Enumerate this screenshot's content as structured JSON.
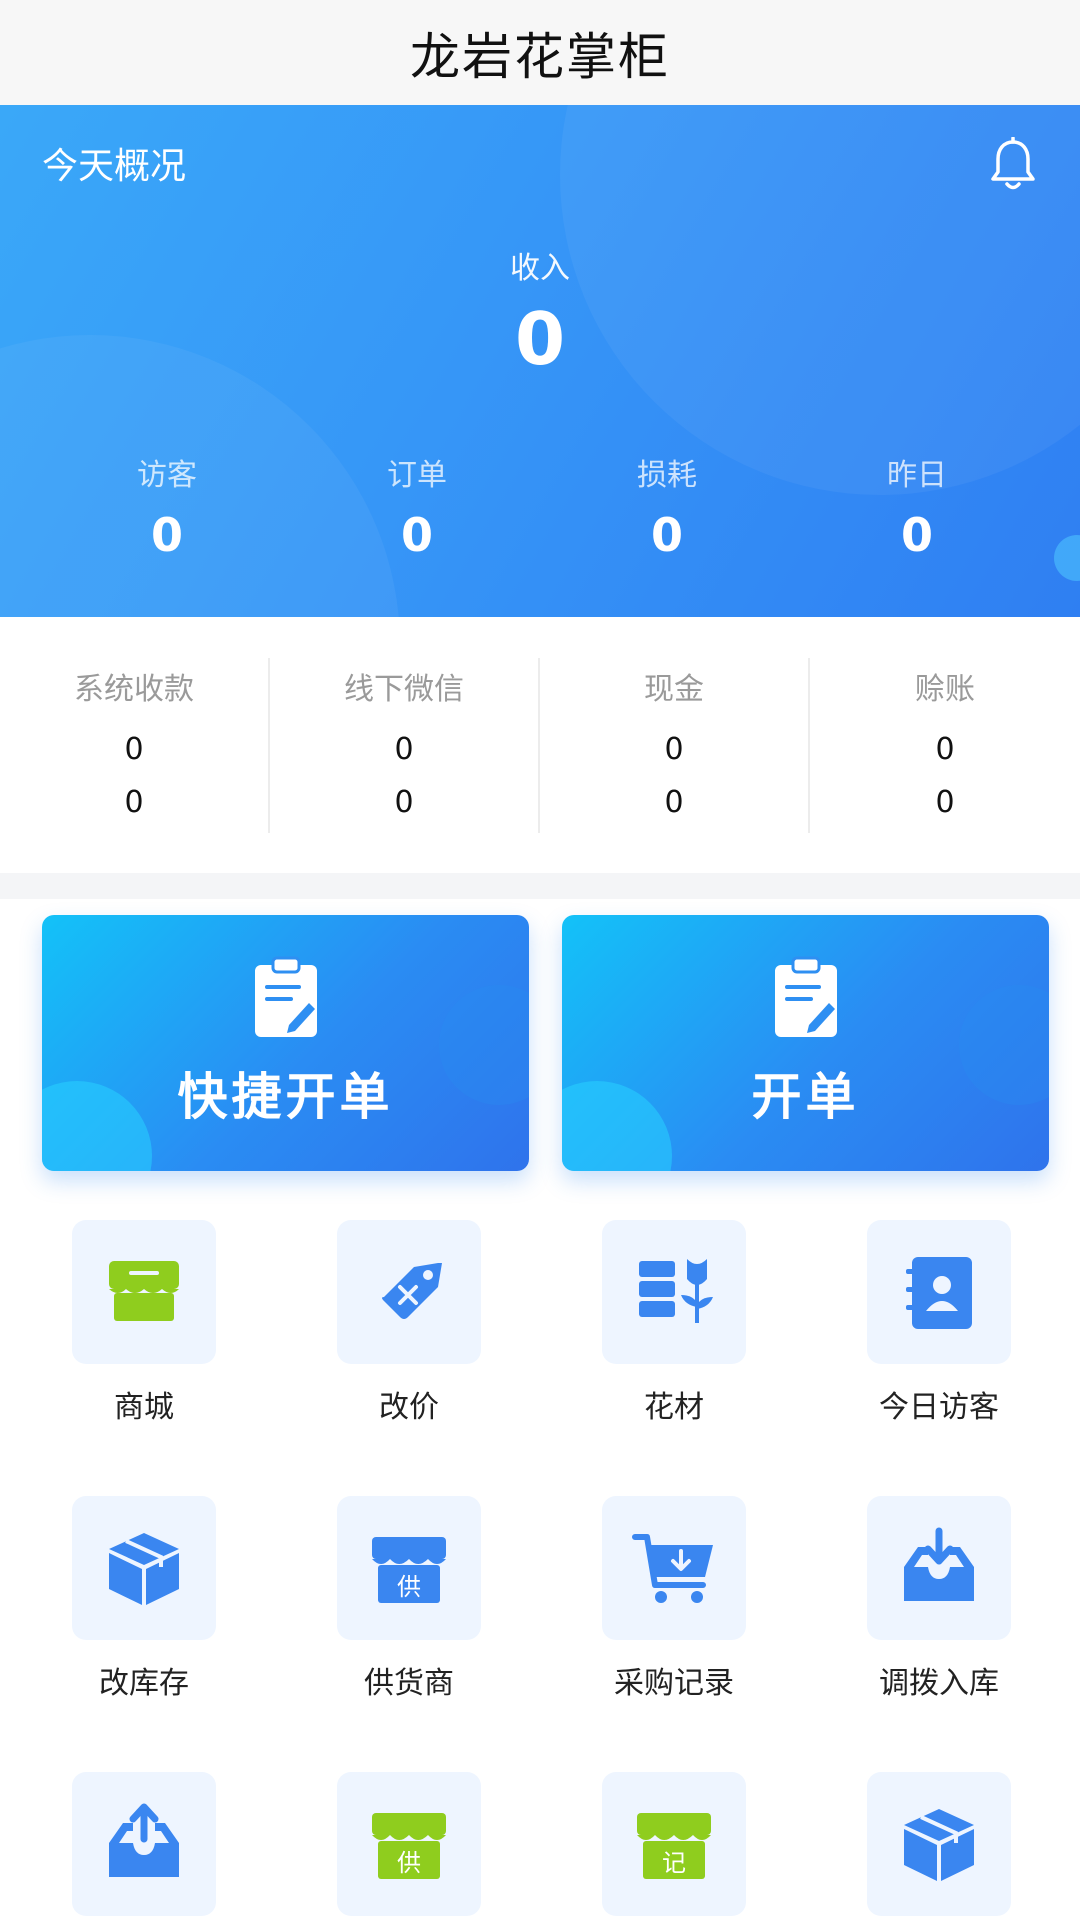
{
  "app": {
    "title": "龙岩花掌柜"
  },
  "overview": {
    "title": "今天概况",
    "income_label": "收入",
    "income_value": "0",
    "stats": [
      {
        "label": "访客",
        "value": "0"
      },
      {
        "label": "订单",
        "value": "0"
      },
      {
        "label": "损耗",
        "value": "0"
      },
      {
        "label": "昨日",
        "value": "0"
      }
    ]
  },
  "payments": [
    {
      "label": "系统收款",
      "value1": "0",
      "value2": "0"
    },
    {
      "label": "线下微信",
      "value1": "0",
      "value2": "0"
    },
    {
      "label": "现金",
      "value1": "0",
      "value2": "0"
    },
    {
      "label": "赊账",
      "value1": "0",
      "value2": "0"
    }
  ],
  "actions": {
    "quick_order": "快捷开单",
    "open_order": "开单"
  },
  "grid": [
    {
      "label": "商城",
      "icon": "store-icon"
    },
    {
      "label": "改价",
      "icon": "price-tag-icon"
    },
    {
      "label": "花材",
      "icon": "flower-material-icon"
    },
    {
      "label": "今日访客",
      "icon": "contact-book-icon"
    },
    {
      "label": "改库存",
      "icon": "box-icon"
    },
    {
      "label": "供货商",
      "icon": "supplier-store-icon"
    },
    {
      "label": "采购记录",
      "icon": "cart-icon"
    },
    {
      "label": "调拨入库",
      "icon": "inbox-in-icon"
    },
    {
      "label": "",
      "icon": "inbox-out-icon"
    },
    {
      "label": "",
      "icon": "supplier-store-green-icon"
    },
    {
      "label": "",
      "icon": "record-store-icon"
    },
    {
      "label": "",
      "icon": "box-icon"
    }
  ],
  "icon_text": {
    "supplier": "供",
    "record": "记"
  },
  "colors": {
    "primary": "#3090f5",
    "icon_blue": "#3a86f0",
    "icon_green": "#8fcd1e",
    "tile_bg": "#eef5ff"
  }
}
